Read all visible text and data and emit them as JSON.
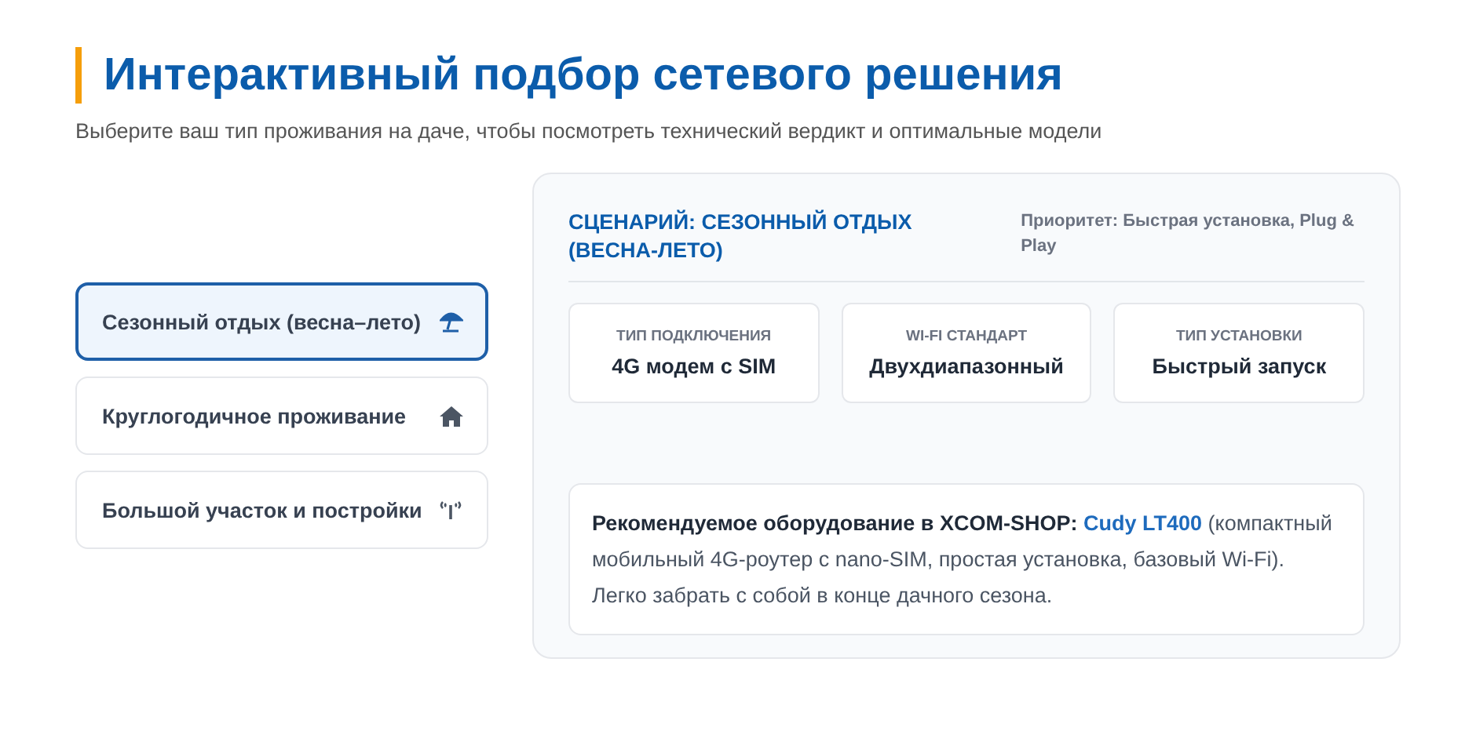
{
  "header": {
    "title": "Интерактивный подбор сетевого решения",
    "subtitle": "Выберите ваш тип проживания на даче, чтобы посмотреть технический вердикт и оптимальные модели"
  },
  "scenarios": [
    {
      "label": "Сезонный отдых (весна–лето)",
      "selected": true
    },
    {
      "label": "Круглогодичное проживание",
      "selected": false
    },
    {
      "label": "Большой участок и постройки",
      "selected": false
    }
  ],
  "panel": {
    "title": "СЦЕНАРИЙ: СЕЗОННЫЙ ОТДЫХ (ВЕСНА-ЛЕТО)",
    "priority": "Приоритет: Быстрая установка, Plug & Play",
    "specs": [
      {
        "label": "ТИП ПОДКЛЮЧЕНИЯ",
        "value": "4G модем с SIM"
      },
      {
        "label": "WI-FI СТАНДАРТ",
        "value": "Двухдиапазонный"
      },
      {
        "label": "ТИП УСТАНОВКИ",
        "value": "Быстрый запуск"
      }
    ],
    "recommendation": {
      "lead": "Рекомендуемое оборудование в XCOM-SHOP:",
      "link": "Cudy LT400",
      "text": "(компактный мобильный 4G-роутер с nano-SIM, простая установка, базовый Wi-Fi). Легко забрать с собой в конце дачного сезона."
    }
  }
}
